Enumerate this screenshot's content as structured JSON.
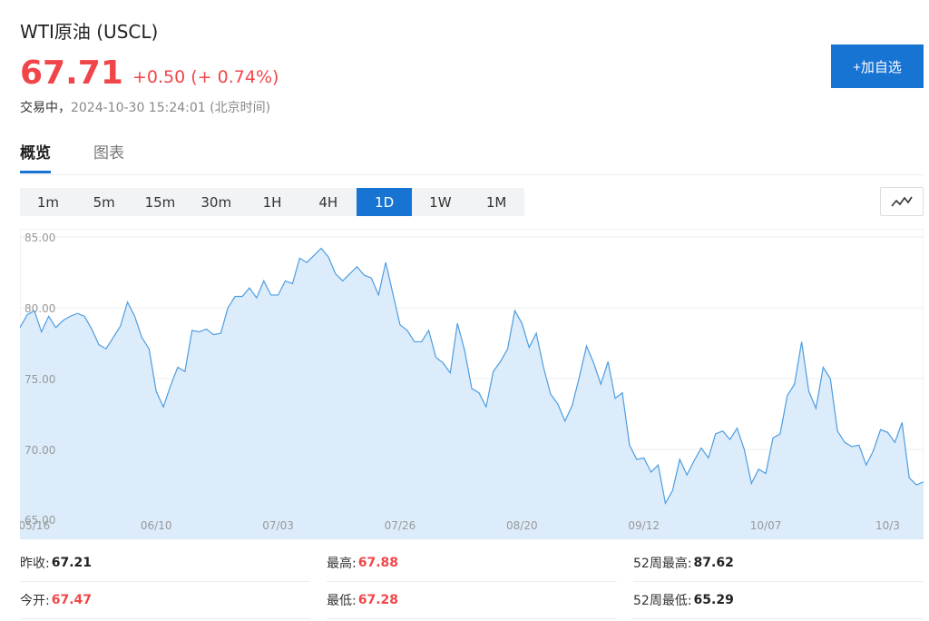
{
  "header": {
    "title": "WTI原油 (USCL)",
    "price": "67.71",
    "change": "+0.50 (+ 0.74%)",
    "status_label": "交易中，",
    "timestamp": "2024-10-30 15:24:01 (北京时间)",
    "add_button": "+加自选"
  },
  "tabs": [
    {
      "label": "概览",
      "active": true
    },
    {
      "label": "图表",
      "active": false
    }
  ],
  "periods": [
    {
      "label": "1m"
    },
    {
      "label": "5m"
    },
    {
      "label": "15m"
    },
    {
      "label": "30m"
    },
    {
      "label": "1H"
    },
    {
      "label": "4H"
    },
    {
      "label": "1D",
      "active": true
    },
    {
      "label": "1W"
    },
    {
      "label": "1M"
    }
  ],
  "chart_type_icon": "line-chart-icon",
  "colors": {
    "accent": "#1874d3",
    "up": "#f0464a",
    "line": "#4d9de0",
    "fill": "#dcecfb"
  },
  "chart_data": {
    "type": "area",
    "title": "",
    "xlabel": "",
    "ylabel": "",
    "ylim": [
      65,
      85
    ],
    "yticks": [
      "85.00",
      "80.00",
      "75.00",
      "70.00",
      "65.00"
    ],
    "x_tick_labels": [
      {
        "label": "05/16",
        "index": 2
      },
      {
        "label": "06/10",
        "index": 19
      },
      {
        "label": "07/03",
        "index": 36
      },
      {
        "label": "07/26",
        "index": 53
      },
      {
        "label": "08/20",
        "index": 70
      },
      {
        "label": "09/12",
        "index": 87
      },
      {
        "label": "10/07",
        "index": 104
      },
      {
        "label": "10/3",
        "index": 121
      }
    ],
    "series": [
      {
        "values": [
          78.6,
          79.5,
          79.8,
          78.3,
          79.4,
          78.6,
          79.1,
          79.4,
          79.6,
          79.4,
          78.5,
          77.4,
          77.1,
          77.9,
          78.7,
          80.4,
          79.4,
          77.9,
          77.1,
          74.1,
          73.0,
          74.5,
          75.8,
          75.5,
          78.4,
          78.3,
          78.5,
          78.1,
          78.2,
          80.0,
          80.8,
          80.8,
          81.4,
          80.7,
          81.9,
          80.9,
          80.9,
          81.9,
          81.7,
          83.5,
          83.2,
          83.7,
          84.2,
          83.6,
          82.4,
          81.9,
          82.4,
          82.9,
          82.3,
          82.1,
          80.9,
          83.2,
          81.0,
          78.8,
          78.4,
          77.6,
          77.6,
          78.4,
          76.5,
          76.1,
          75.4,
          78.9,
          77.0,
          74.3,
          74.0,
          73.0,
          75.5,
          76.2,
          77.1,
          79.8,
          78.9,
          77.2,
          78.2,
          75.8,
          73.9,
          73.2,
          72.0,
          73.1,
          75.1,
          77.3,
          76.1,
          74.6,
          76.2,
          73.6,
          74.0,
          70.3,
          69.3,
          69.4,
          68.4,
          68.9,
          66.2,
          67.1,
          69.3,
          68.2,
          69.2,
          70.1,
          69.4,
          71.1,
          71.3,
          70.7,
          71.5,
          70.0,
          67.6,
          68.6,
          68.3,
          70.8,
          71.1,
          73.8,
          74.6,
          77.6,
          74.1,
          72.9,
          75.8,
          75.0,
          71.3,
          70.5,
          70.2,
          70.3,
          68.9,
          69.9,
          71.4,
          71.2,
          70.5,
          71.9,
          68.0,
          67.5,
          67.7
        ]
      }
    ]
  },
  "stats": {
    "prev_close_label": "昨收:",
    "prev_close": "67.21",
    "high_label": "最高:",
    "high": "67.88",
    "high52_label": "52周最高:",
    "high52": "87.62",
    "open_label": "今开:",
    "open": "67.47",
    "low_label": "最低:",
    "low": "67.28",
    "low52_label": "52周最低:",
    "low52": "65.29"
  }
}
